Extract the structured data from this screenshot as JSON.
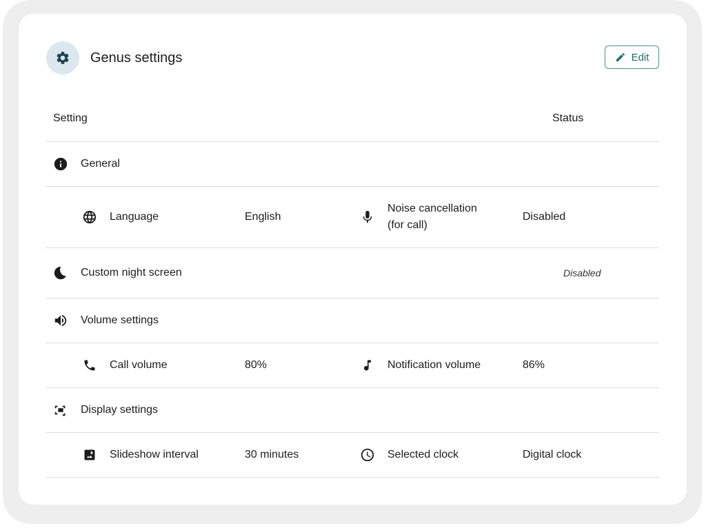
{
  "header": {
    "title": "Genus settings",
    "icon": "gear-icon",
    "edit_label": "Edit"
  },
  "table": {
    "col_setting": "Setting",
    "col_status": "Status"
  },
  "sections": {
    "general": {
      "label": "General",
      "icon": "info-icon",
      "items": [
        {
          "label": "Language",
          "icon": "globe-icon",
          "value": "English"
        },
        {
          "label_line1": "Noise cancellation",
          "label_line2": "(for call)",
          "icon": "microphone-icon",
          "value": "Disabled"
        }
      ]
    },
    "night": {
      "label": "Custom night screen",
      "icon": "moon-icon",
      "status": "Disabled"
    },
    "volume": {
      "label": "Volume settings",
      "icon": "speaker-icon",
      "items": [
        {
          "label": "Call volume",
          "icon": "phone-icon",
          "value": "80%"
        },
        {
          "label": "Notification volume",
          "icon": "music-note-icon",
          "value": "86%"
        }
      ]
    },
    "display": {
      "label": "Display settings",
      "icon": "screen-icon",
      "items": [
        {
          "label": "Slideshow interval",
          "icon": "photo-icon",
          "value": "30 minutes"
        },
        {
          "label": "Selected clock",
          "icon": "clock-icon",
          "value": "Digital clock"
        }
      ]
    }
  },
  "colors": {
    "accent": "#1f6b68",
    "header_icon_bg": "#dce8ef",
    "divider": "#dedede",
    "frame": "#eeeeee"
  }
}
